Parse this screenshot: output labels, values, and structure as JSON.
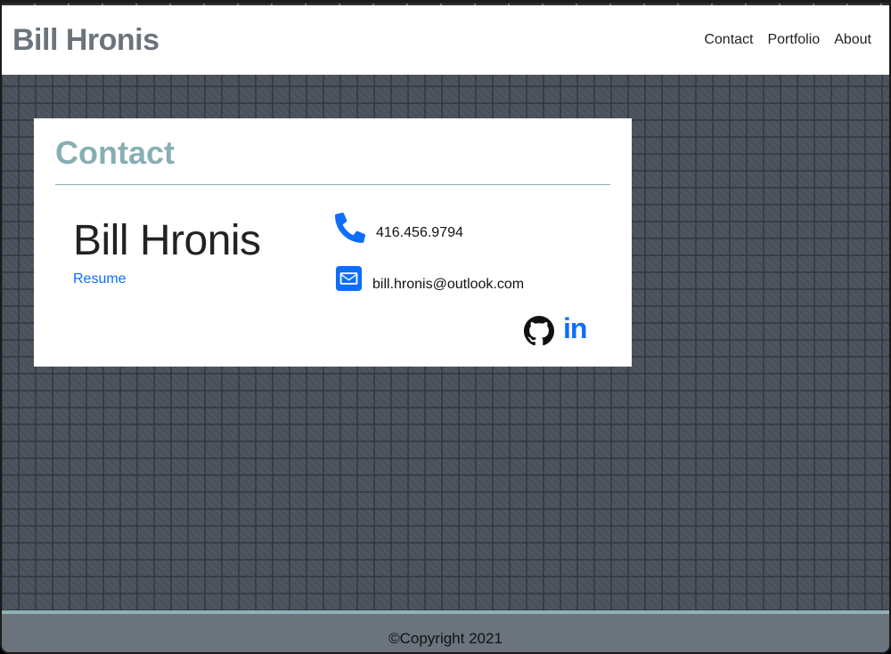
{
  "header": {
    "brand": "Bill Hronis",
    "nav": [
      "Contact",
      "Portfolio",
      "About"
    ]
  },
  "card": {
    "title": "Contact",
    "name": "Bill Hronis",
    "resume_link": "Resume",
    "phone": "416.456.9794",
    "email": "bill.hronis@outlook.com",
    "linkedin_glyph": "in",
    "icons": [
      "phone-icon",
      "envelope-icon",
      "github-icon",
      "linkedin-icon"
    ]
  },
  "footer": {
    "text": "©Copyright 2021"
  },
  "colors": {
    "accent": "#87aeb3",
    "link": "#0d6efd",
    "brand": "#6b737c"
  }
}
